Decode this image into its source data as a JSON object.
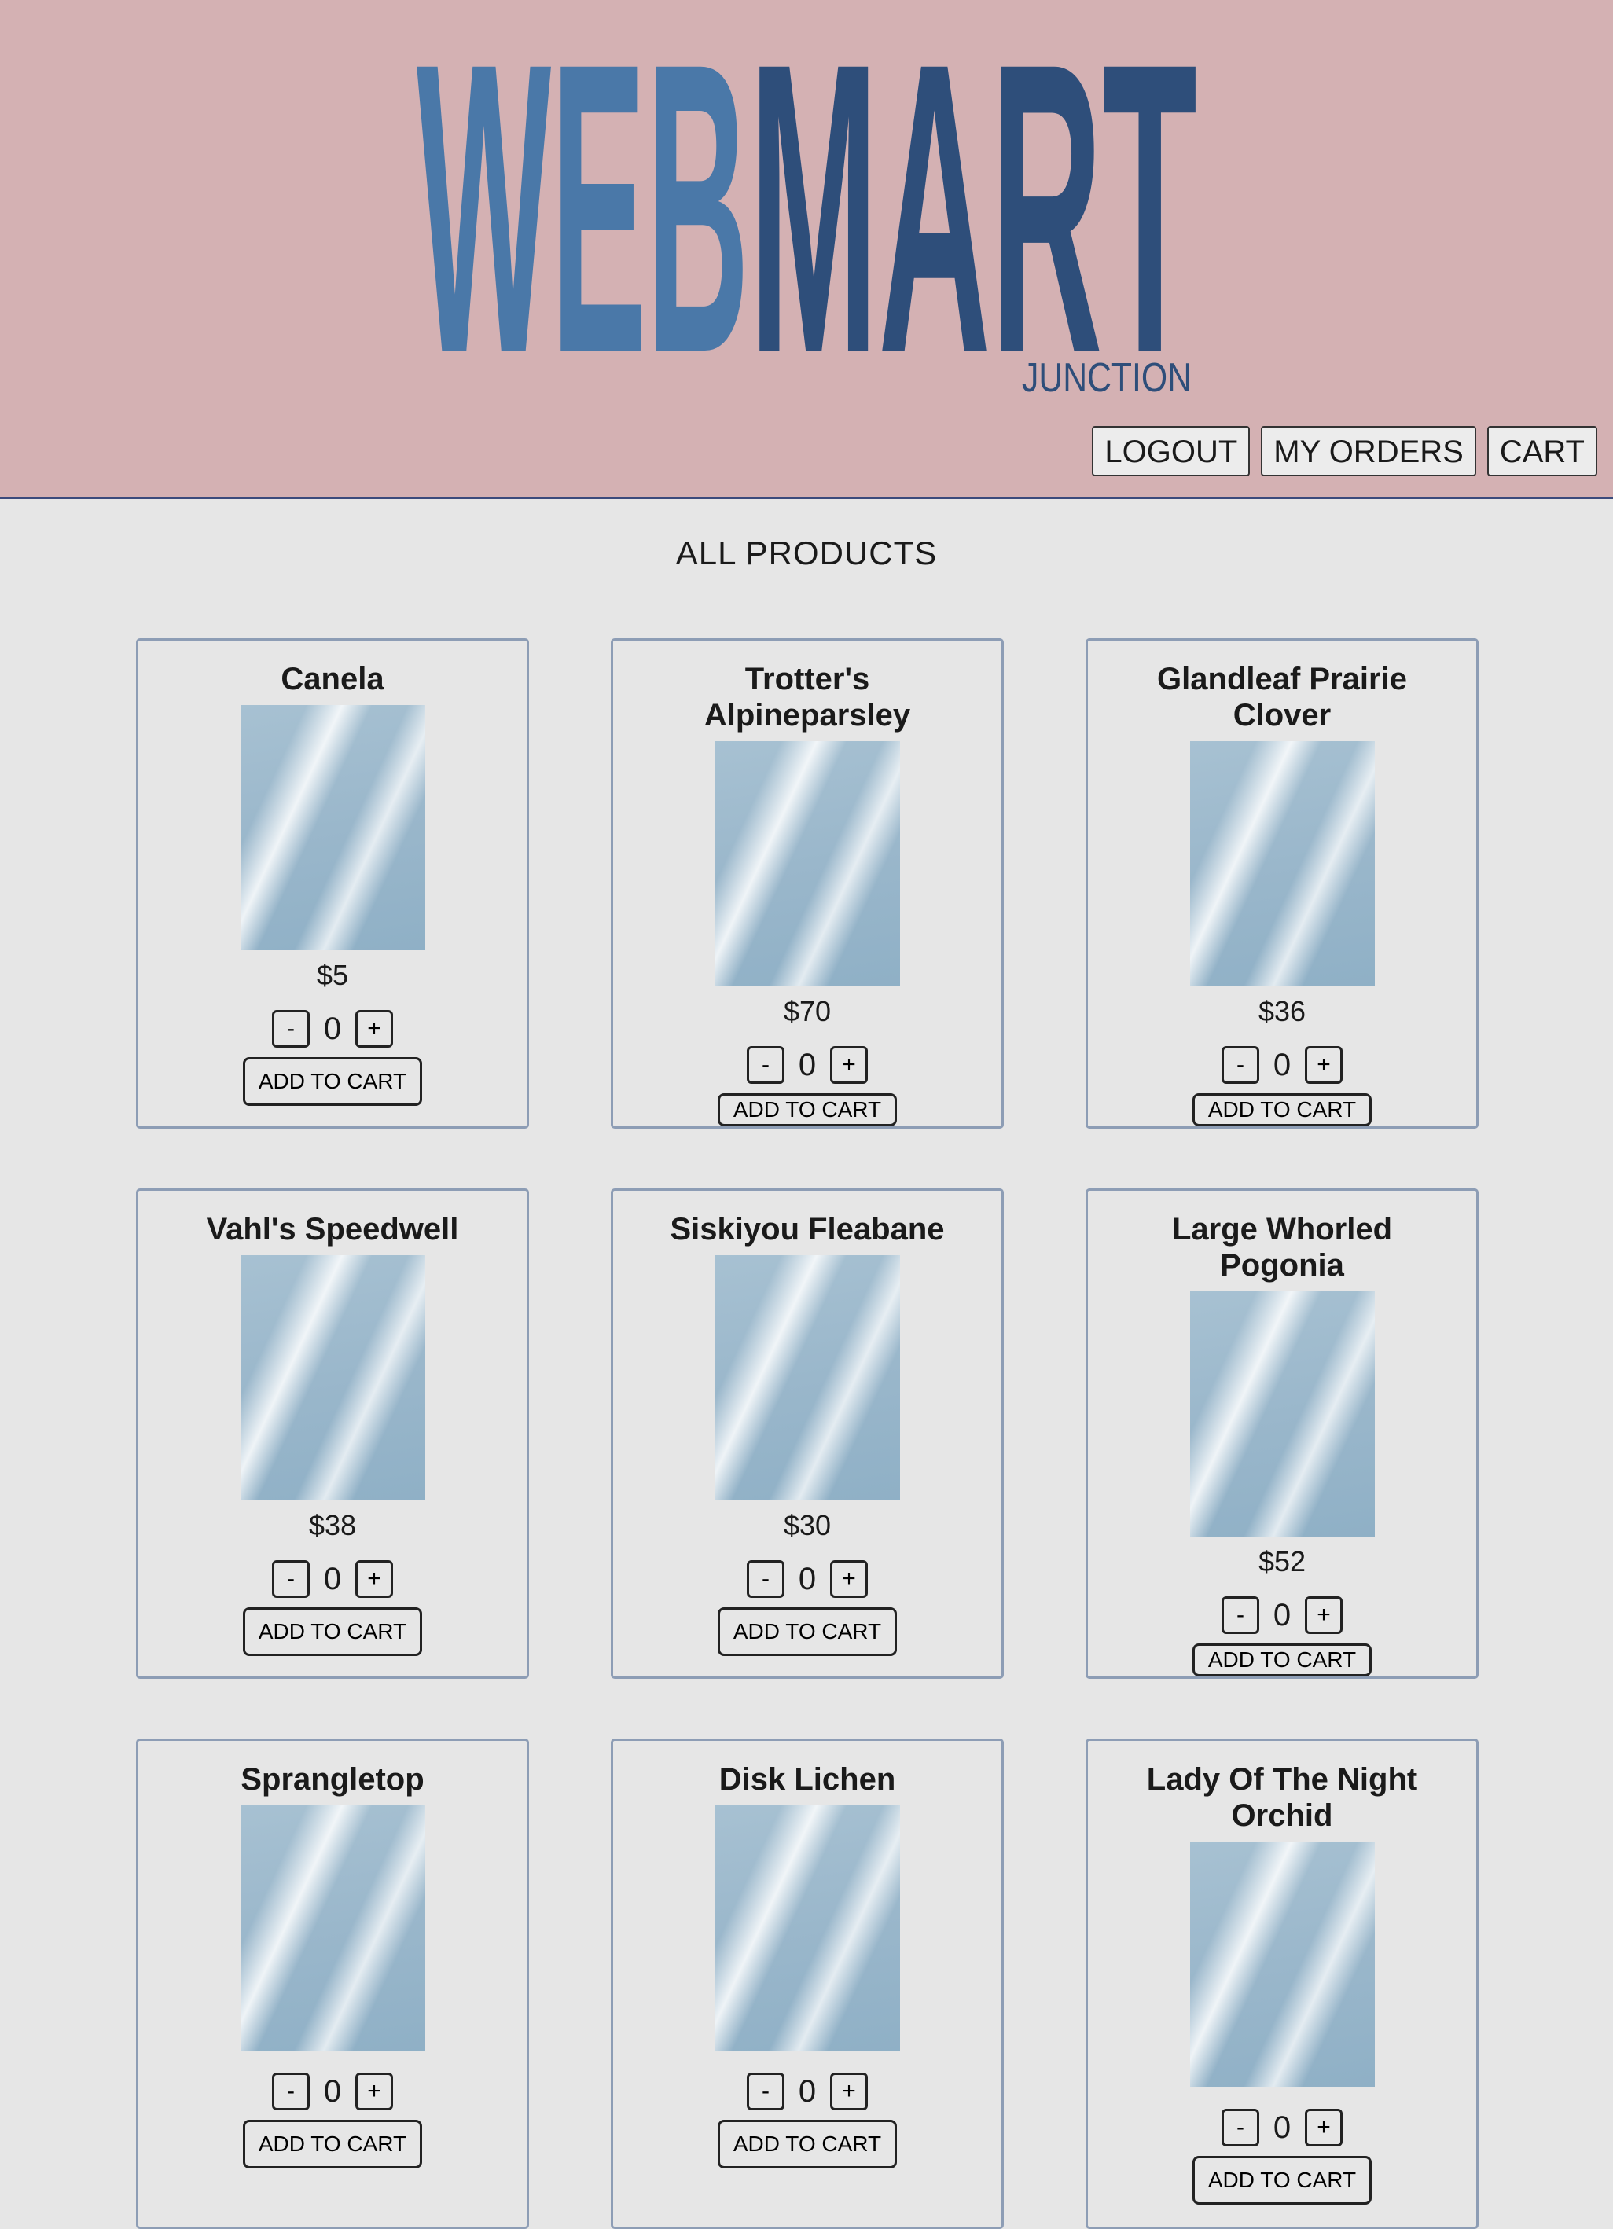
{
  "header": {
    "logo": {
      "part1": "WEB",
      "part2": "MART",
      "tagline": "JUNCTION",
      "colors": {
        "part1": "#4a78a8",
        "part2": "#2e4e7a",
        "tagline": "#2e4e7a",
        "background": "#d4b1b3"
      }
    },
    "nav": {
      "logout": "LOGOUT",
      "orders": "MY ORDERS",
      "cart": "CART"
    }
  },
  "main": {
    "heading": "ALL PRODUCTS",
    "products": [
      {
        "name": "Canela",
        "price": "$5",
        "qty": "0",
        "minus": "-",
        "plus": "+",
        "add": "ADD TO CART"
      },
      {
        "name": "Trotter's Alpineparsley",
        "price": "$70",
        "qty": "0",
        "minus": "-",
        "plus": "+",
        "add": "ADD TO CART"
      },
      {
        "name": "Glandleaf Prairie Clover",
        "price": "$36",
        "qty": "0",
        "minus": "-",
        "plus": "+",
        "add": "ADD TO CART"
      },
      {
        "name": "Vahl's Speedwell",
        "price": "$38",
        "qty": "0",
        "minus": "-",
        "plus": "+",
        "add": "ADD TO CART"
      },
      {
        "name": "Siskiyou Fleabane",
        "price": "$30",
        "qty": "0",
        "minus": "-",
        "plus": "+",
        "add": "ADD TO CART"
      },
      {
        "name": "Large Whorled Pogonia",
        "price": "$52",
        "qty": "0",
        "minus": "-",
        "plus": "+",
        "add": "ADD TO CART"
      },
      {
        "name": "Sprangletop",
        "price": "",
        "qty": "0",
        "minus": "-",
        "plus": "+",
        "add": "ADD TO CART"
      },
      {
        "name": "Disk Lichen",
        "price": "",
        "qty": "0",
        "minus": "-",
        "plus": "+",
        "add": "ADD TO CART"
      },
      {
        "name": "Lady Of The Night Orchid",
        "price": "",
        "qty": "0",
        "minus": "-",
        "plus": "+",
        "add": "ADD TO CART"
      }
    ]
  }
}
